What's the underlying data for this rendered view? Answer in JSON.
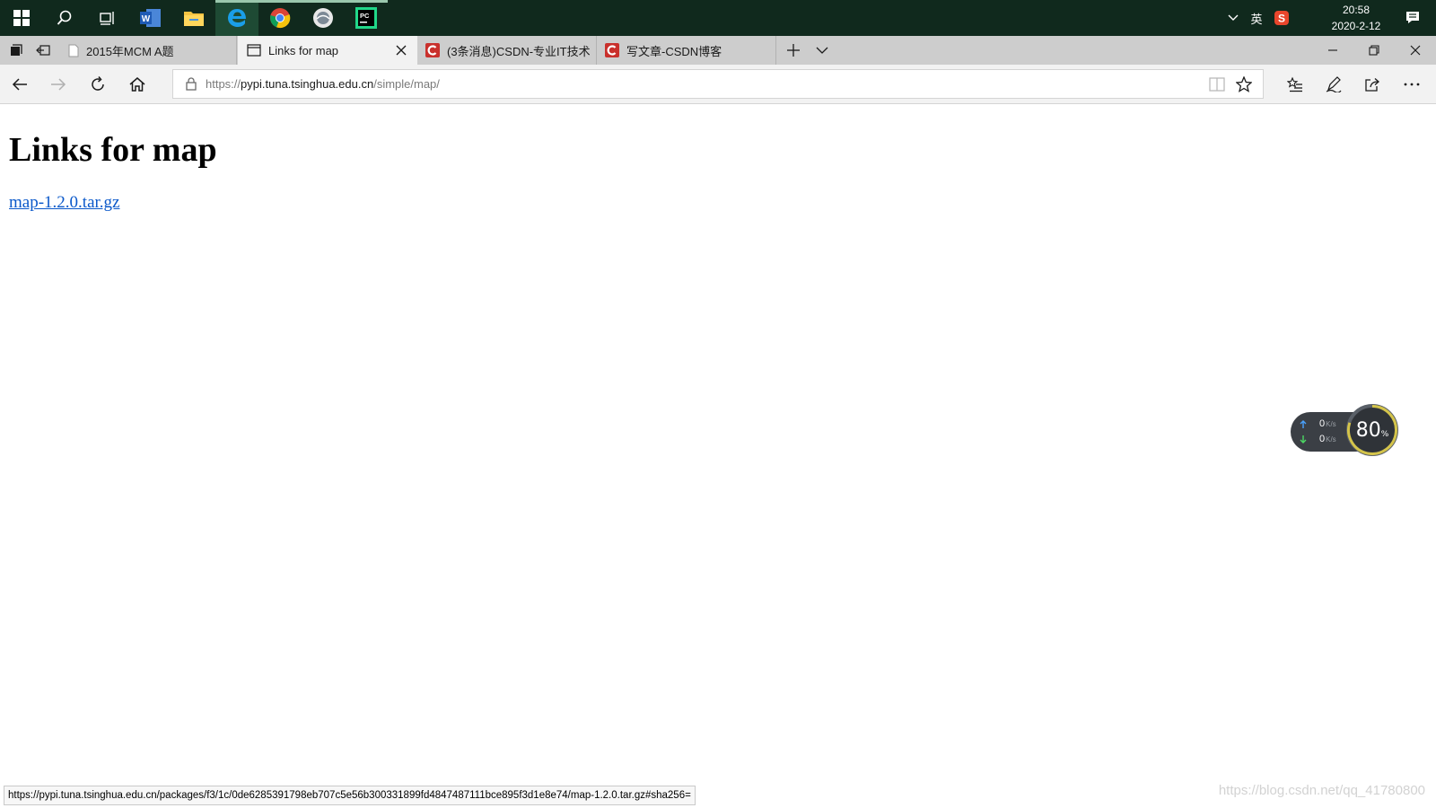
{
  "taskbar": {
    "apps": [
      "start",
      "search",
      "task-view",
      "word",
      "file-explorer",
      "edge",
      "chrome",
      "photo-app",
      "pycharm"
    ],
    "tray": {
      "ime_label": "英",
      "time": "20:58",
      "date": "2020-2-12"
    }
  },
  "tabs": [
    {
      "title": "2015年MCM A题",
      "active": false,
      "icon": "page-icon"
    },
    {
      "title": "Links for map",
      "active": true,
      "icon": "page-icon"
    },
    {
      "title": "(3条消息)CSDN-专业IT技术",
      "active": false,
      "icon": "csdn-icon"
    },
    {
      "title": "写文章-CSDN博客",
      "active": false,
      "icon": "csdn-icon"
    }
  ],
  "address_bar": {
    "scheme": "https://",
    "host": "pypi.tuna.tsinghua.edu.cn",
    "path": "/simple/map/"
  },
  "page": {
    "heading": "Links for map",
    "links": [
      {
        "text": "map-1.2.0.tar.gz"
      }
    ]
  },
  "net_monitor": {
    "upload_value": "0",
    "download_value": "0",
    "unit": "K/s",
    "percent": "80",
    "percent_sign": "%"
  },
  "status_bar": {
    "hover_url": "https://pypi.tuna.tsinghua.edu.cn/packages/f3/1c/0de6285391798eb707c5e56b300331899fd4847487111bce895f3d1e8e74/map-1.2.0.tar.gz#sha256="
  },
  "watermark": "https://blog.csdn.net/qq_41780800",
  "colors": {
    "taskbar_bg": "#10291d",
    "tabstrip_bg": "#cdcdcd",
    "active_tab_bg": "#f2f2f2",
    "link": "#0a58ca",
    "csdn_red": "#c9302c"
  }
}
